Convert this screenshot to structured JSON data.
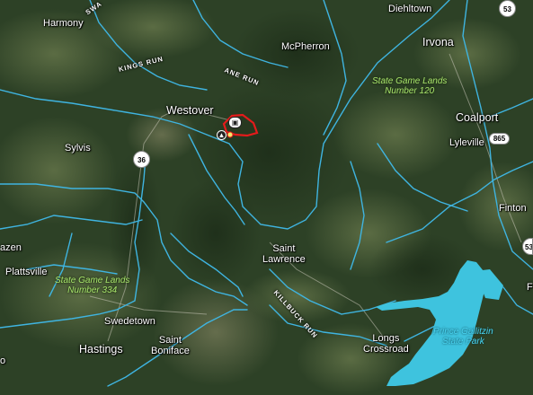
{
  "places": {
    "harmony": "Harmony",
    "diehltown": "Diehltown",
    "mcpherron": "McPherron",
    "irvona": "Irvona",
    "westover": "Westover",
    "coalport": "Coalport",
    "sylvis": "Sylvis",
    "lyleville": "Lyleville",
    "finton": "Finton",
    "saint_lawrence": "Saint\nLawrence",
    "azen": "azen",
    "plattsville": "Plattsville",
    "swedetown": "Swedetown",
    "hastings": "Hastings",
    "saint_boniface": "Saint\nBoniface",
    "longs_crossroad": "Longs\nCrossroad",
    "f_edge": "F",
    "o_edge": "o"
  },
  "parks": {
    "sgl_120": "State Game Lands\nNumber 120",
    "sgl_334": "State Game Lands\nNumber 334",
    "prince_gallitzin": "Prince Gallitzin\nState Park"
  },
  "streams": {
    "kings_run": "KINGS RUN",
    "ane_run": "ANE RUN",
    "killbuck_run": "KILLBUCK RUN",
    "swa_run": "SWA"
  },
  "route_shields": {
    "r53_top": "53",
    "r36": "36",
    "r865": "865",
    "r53_right": "53"
  },
  "markers": {
    "camera": "camera-icon",
    "fire": "fire-icon"
  },
  "colors": {
    "river": "#3fb4e0",
    "lake": "#3ec3de",
    "incident_outline": "#e41b1b",
    "park_label": "#a7e36b",
    "water_label": "#48d3f0"
  }
}
